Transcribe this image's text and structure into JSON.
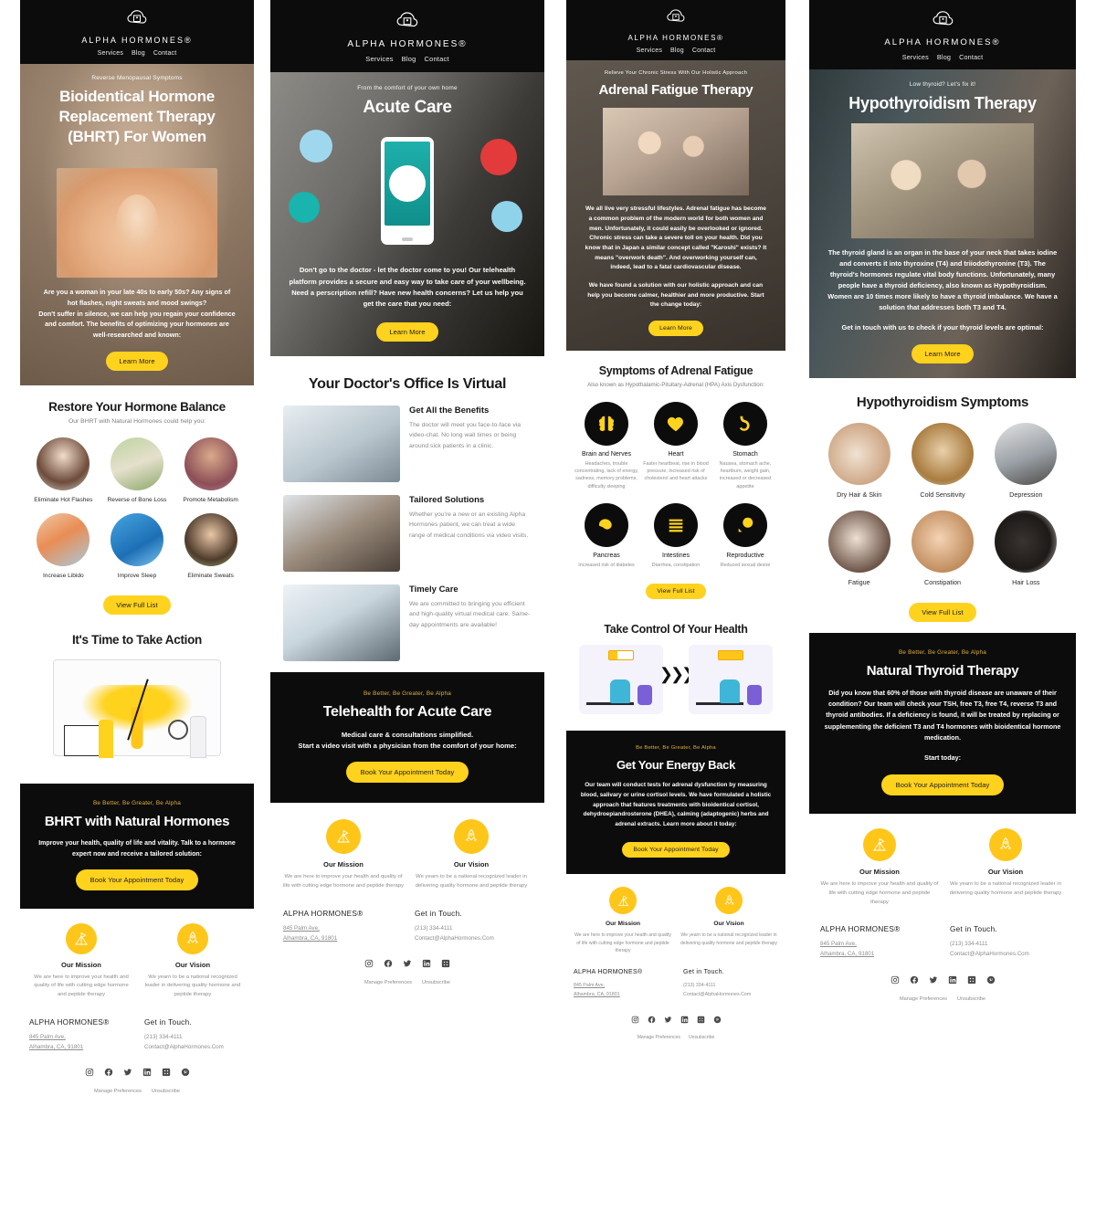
{
  "brand": {
    "name": "ALPHA HORMONES®",
    "logo_icon": "cloud-family-icon",
    "nav": [
      "Services",
      "Blog",
      "Contact"
    ],
    "accent_yellow": "#ffd21e",
    "dark": "#0c0c0c"
  },
  "footer": {
    "mission": {
      "icon": "mountain-flag-icon",
      "title": "Our Mission",
      "text": "We are here to improve your health and quality of life with cutting edge hormone and peptide therapy"
    },
    "vision": {
      "icon": "rocket-icon",
      "title": "Our Vision",
      "text": "We yearn to be a national recognized leader in delivering quality hormone and peptide therapy"
    },
    "brand_heading": "ALPHA HORMONES®",
    "address_line1": "845 Palm Ave,",
    "address_line2": "Alhambra, CA, 91801",
    "touch_heading": "Get in Touch.",
    "phone": "(213) 334-4111",
    "email": "Contact@AlphaHormones.Com",
    "social": [
      "instagram-icon",
      "facebook-icon",
      "twitter-icon",
      "linkedin-icon",
      "yelp-icon",
      "pinterest-icon"
    ],
    "legal": [
      "Manage Preferences",
      "Unsubscribe"
    ]
  },
  "columns": [
    {
      "id": "bhrt",
      "hero": {
        "eyebrow": "Reverse Menopausal Symptoms",
        "title": "Bioidentical Hormone Replacement Therapy (BHRT) For Women",
        "body": "Are you a woman in your late 40s to early 50s? Any signs of hot flashes, night sweats and mood swings?\nDon't suffer in silence, we can help you regain your confidence and comfort. The benefits of optimizing your hormones are well-researched and known:",
        "button": "Learn More",
        "image": "woman-hot-flash-photo"
      },
      "benefits": {
        "title": "Restore Your Hormone Balance",
        "subtitle": "Our BHRT with Natural Hormones could help you:",
        "items": [
          {
            "label": "Eliminate Hot Flashes",
            "image": "smiling-woman-photo"
          },
          {
            "label": "Reverse of Bone Loss",
            "image": "woman-stretching-photo"
          },
          {
            "label": "Promote Metabolism",
            "image": "smiling-woman-pink-photo"
          },
          {
            "label": "Increase Libido",
            "image": "couple-embrace-photo"
          },
          {
            "label": "Improve Sleep",
            "image": "sleeping-person-photo"
          },
          {
            "label": "Eliminate Sweats",
            "image": "woman-outdoors-photo"
          }
        ],
        "button": "View Full List"
      },
      "action": {
        "title": "It's Time to Take Action",
        "image": "uterus-diagram-illustration"
      },
      "cta": {
        "tag": "Be Better, Be Greater, Be Alpha",
        "title": "BHRT with Natural Hormones",
        "body": "Improve your health, quality of life and vitality. Talk to a hormone expert now and receive a tailored solution:",
        "button": "Book Your Appointment Today"
      }
    },
    {
      "id": "acute",
      "hero": {
        "eyebrow": "From the comfort of your own home",
        "title": "Acute Care",
        "body": "Don't go to the doctor - let the doctor come to you!\nOur telehealth platform provides a secure and easy way to take care of your wellbeing. Need a perscription refill? Have new health concerns? Let us help you get the care that you need:",
        "button": "Learn More",
        "image": "doctor-with-phone-illustration"
      },
      "features": {
        "title": "Your Doctor's Office Is Virtual",
        "items": [
          {
            "heading": "Get All the Benefits",
            "text": "The doctor will meet you face-to-face via video-chat. No long wait times or being around sick patients in a clinic.",
            "image": "phone-video-call-photo"
          },
          {
            "heading": "Tailored Solutions",
            "text": "Whether you're a new or an existing Alpha Hormones patient, we can treat a wide range of medical conditions via video visits.",
            "image": "parent-with-baby-laptop-photo"
          },
          {
            "heading": "Timely Care",
            "text": "We are committed to bringing you efficient and high-quality virtual medical care. Same-day appointments are available!",
            "image": "doctor-laptop-photo"
          }
        ]
      },
      "cta": {
        "tag": "Be Better, Be Greater, Be Alpha",
        "title": "Telehealth for Acute Care",
        "body": "Medical care & consultations simplified.\nStart a video visit with a physician from the comfort of your home:",
        "button": "Book Your Appointment Today"
      }
    },
    {
      "id": "adrenal",
      "hero": {
        "eyebrow": "Relieve Your Chronic Stress With Our Holistic Approach",
        "title": "Adrenal Fatigue Therapy",
        "body": "We all live very stressful lifestyles.\nAdrenal fatigue has become a common problem of the modern world for both women and men. Unfortunately, it could easily be overlooked or ignored. Chronic stress can take a severe toll on your health. Did you know that in Japan a similar concept called \"Karoshi\" exists? It means \"overwork death\". And overworking yourself can, indeed, lead to a fatal cardiovascular disease.",
        "body2": "We have found a solution with our holistic approach and can help you become calmer, healthier and more productive. Start the change today:",
        "button": "Learn More",
        "image": "stressed-couple-photo"
      },
      "symptoms": {
        "title": "Symptoms of Adrenal Fatigue",
        "subtitle": "Also known as Hypothalamic-Pituitary-Adrenal (HPA) Axis Dysfunction:",
        "items": [
          {
            "icon": "brain-icon",
            "label": "Brain and Nerves",
            "desc": "Headaches, trouble concentrating, lack of energy, sadness, memory problems, difficulty sleeping"
          },
          {
            "icon": "heart-icon",
            "label": "Heart",
            "desc": "Faster heartbeat, rise in blood pressure, increased risk of cholesterol and heart attacks"
          },
          {
            "icon": "stomach-icon",
            "label": "Stomach",
            "desc": "Nausea, stomach ache, heartburn, weight gain, increased or decreased appetite"
          },
          {
            "icon": "pancreas-icon",
            "label": "Pancreas",
            "desc": "Increased risk of diabetes"
          },
          {
            "icon": "intestines-icon",
            "label": "Intestines",
            "desc": "Diarrhea, constipation"
          },
          {
            "icon": "reproductive-icon",
            "label": "Reproductive",
            "desc": "Reduced sexual desire"
          }
        ],
        "button": "View Full List"
      },
      "control": {
        "title": "Take Control Of Your Health",
        "image": "tired-to-energized-illustration"
      },
      "cta": {
        "tag": "Be Better, Be Greater, Be Alpha",
        "title": "Get Your Energy Back",
        "body": "Our team will conduct tests for adrenal dysfunction by measuring blood, salivary or urine cortisol levels. We have formulated a holistic approach that features treatments with bioidentical cortisol, dehydroepiandrosterone (DHEA), calming (adaptogenic) herbs and adrenal extracts. Learn more about it today:",
        "button": "Book Your Appointment Today"
      }
    },
    {
      "id": "hypothyroid",
      "hero": {
        "eyebrow": "Low thyroid? Let's fix it!",
        "title": "Hypothyroidism Therapy",
        "body": "The thyroid gland is an organ in the base of your neck that takes iodine and converts it into thyroxine (T4) and triiodothyronine (T3). The thyroid's hormones regulate vital body functions. Unfortunately, many people have a thyroid deficiency, also known as Hypothyroidism. Women are 10 times more likely to have a thyroid imbalance. We have a solution that addresses both T3 and T4.",
        "body2": "Get in touch with us to check if your thyroid levels are optimal:",
        "button": "Learn More",
        "image": "doctor-examining-thyroid-photo"
      },
      "symptoms": {
        "title": "Hypothyroidism Symptoms",
        "items": [
          {
            "label": "Dry Hair & Skin",
            "image": "dry-hands-photo"
          },
          {
            "label": "Cold Sensitivity",
            "image": "cold-man-coat-photo"
          },
          {
            "label": "Depression",
            "image": "person-lying-down-photo"
          },
          {
            "label": "Fatigue",
            "image": "tired-woman-photo"
          },
          {
            "label": "Constipation",
            "image": "stomach-hands-photo"
          },
          {
            "label": "Hair Loss",
            "image": "hair-loss-photo"
          }
        ],
        "button": "View Full List"
      },
      "cta": {
        "tag": "Be Better, Be Greater, Be Alpha",
        "title": "Natural Thyroid Therapy",
        "body": "Did you know that 60% of those with thyroid disease are unaware of their condition? Our team will check your TSH, free T3, free T4, reverse T3 and thyroid antibodies. If a deficiency is found, it will be treated by replacing or supplementing the deficient T3 and T4 hormones with bioidentical hormone medication.",
        "body2": "Start today:",
        "button": "Book Your Appointment Today"
      }
    }
  ]
}
